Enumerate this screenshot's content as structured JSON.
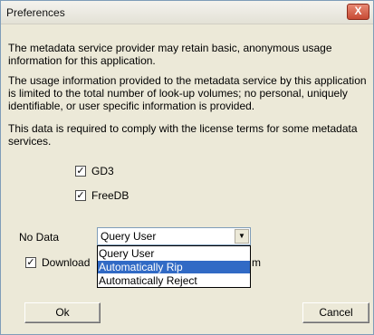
{
  "window": {
    "title": "Preferences",
    "close_glyph": "X"
  },
  "body": {
    "para1": "The metadata service provider may retain basic, anonymous usage information for this application.",
    "para2": "The usage information provided to the metadata service by this application is limited to the total number of look-up volumes; no personal, uniquely identifiable, or user specific information is provided.",
    "para3": "This data is required to comply with the license terms for some metadata services."
  },
  "checkboxes": [
    {
      "label": "GD3",
      "checked": true
    },
    {
      "label": "FreeDB",
      "checked": true
    }
  ],
  "no_data": {
    "label": "No Data",
    "selected": "Query User",
    "options": [
      "Query User",
      "Automatically Rip",
      "Automatically Reject"
    ],
    "highlighted": "Automatically Rip"
  },
  "download": {
    "label": "Download",
    "label_suffix": "m",
    "checked": true
  },
  "buttons": {
    "ok": "Ok",
    "cancel": "Cancel"
  },
  "icons": {
    "close": "close-icon",
    "check": "check-icon",
    "dropdown": "chevron-down-icon"
  }
}
